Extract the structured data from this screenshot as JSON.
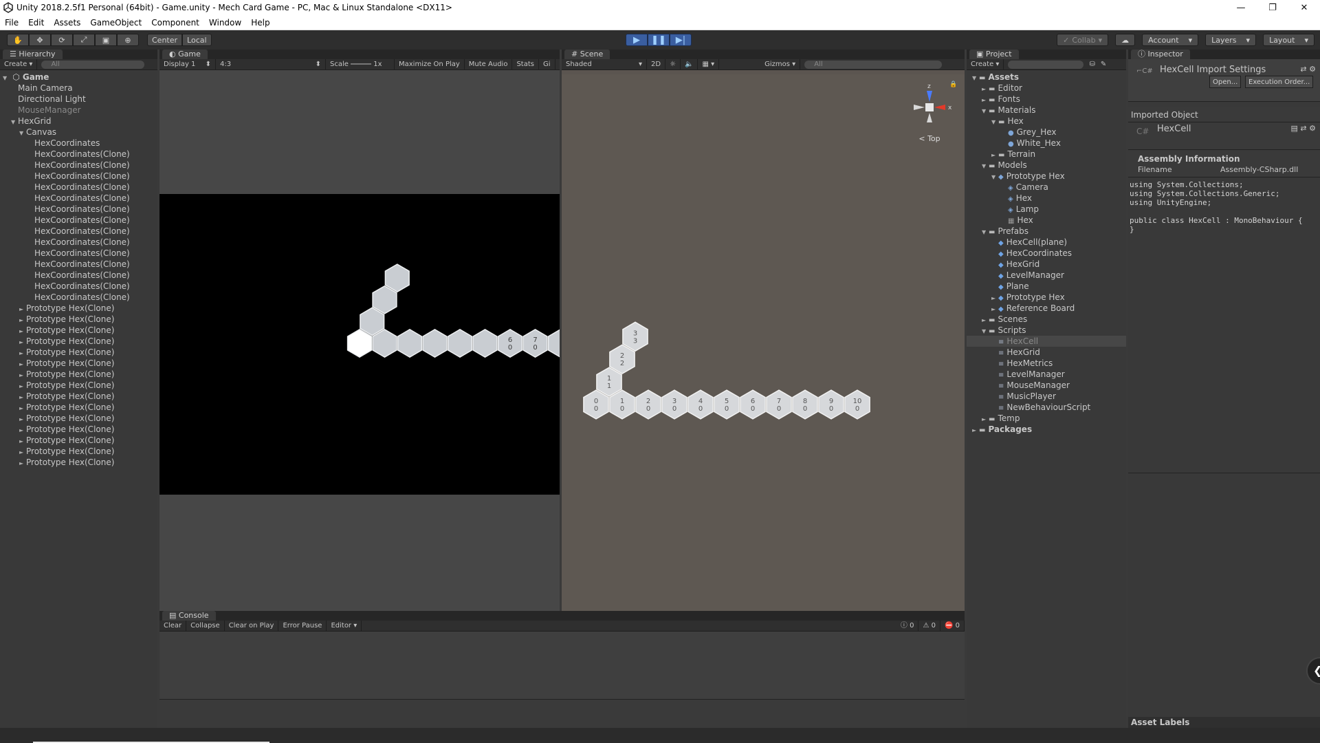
{
  "window": {
    "title": "Unity 2018.2.5f1 Personal (64bit) - Game.unity - Mech Card Game - PC, Mac & Linux Standalone <DX11>",
    "controls": [
      "minimize-icon",
      "restore-icon",
      "close-icon"
    ]
  },
  "menu": [
    "File",
    "Edit",
    "Assets",
    "GameObject",
    "Component",
    "Window",
    "Help"
  ],
  "toolbar": {
    "tools": [
      "hand-icon",
      "move-icon",
      "rotate-icon",
      "scale-icon",
      "rect-icon",
      "transform-icon"
    ],
    "pivot": "Center",
    "space": "Local",
    "play_state": "playing",
    "collab": "Collab",
    "account": "Account",
    "layers": "Layers",
    "layout": "Layout",
    "accent": "#3a5ea0"
  },
  "hierarchy": {
    "tab": "Hierarchy",
    "create": "Create",
    "search_placeholder": "All",
    "scene": "Game",
    "items": [
      {
        "label": "Main Camera",
        "depth": 1,
        "arrow": "",
        "dim": false
      },
      {
        "label": "Directional Light",
        "depth": 1,
        "arrow": "",
        "dim": false
      },
      {
        "label": "MouseManager",
        "depth": 1,
        "arrow": "",
        "dim": true
      },
      {
        "label": "HexGrid",
        "depth": 1,
        "arrow": "▼",
        "dim": false
      },
      {
        "label": "Canvas",
        "depth": 2,
        "arrow": "▼",
        "dim": false
      },
      {
        "label": "HexCoordinates",
        "depth": 3,
        "arrow": "",
        "dim": false
      },
      {
        "label": "HexCoordinates(Clone)",
        "depth": 3,
        "arrow": "",
        "dim": false
      },
      {
        "label": "HexCoordinates(Clone)",
        "depth": 3,
        "arrow": "",
        "dim": false
      },
      {
        "label": "HexCoordinates(Clone)",
        "depth": 3,
        "arrow": "",
        "dim": false
      },
      {
        "label": "HexCoordinates(Clone)",
        "depth": 3,
        "arrow": "",
        "dim": false
      },
      {
        "label": "HexCoordinates(Clone)",
        "depth": 3,
        "arrow": "",
        "dim": false
      },
      {
        "label": "HexCoordinates(Clone)",
        "depth": 3,
        "arrow": "",
        "dim": false
      },
      {
        "label": "HexCoordinates(Clone)",
        "depth": 3,
        "arrow": "",
        "dim": false
      },
      {
        "label": "HexCoordinates(Clone)",
        "depth": 3,
        "arrow": "",
        "dim": false
      },
      {
        "label": "HexCoordinates(Clone)",
        "depth": 3,
        "arrow": "",
        "dim": false
      },
      {
        "label": "HexCoordinates(Clone)",
        "depth": 3,
        "arrow": "",
        "dim": false
      },
      {
        "label": "HexCoordinates(Clone)",
        "depth": 3,
        "arrow": "",
        "dim": false
      },
      {
        "label": "HexCoordinates(Clone)",
        "depth": 3,
        "arrow": "",
        "dim": false
      },
      {
        "label": "HexCoordinates(Clone)",
        "depth": 3,
        "arrow": "",
        "dim": false
      },
      {
        "label": "HexCoordinates(Clone)",
        "depth": 3,
        "arrow": "",
        "dim": false
      },
      {
        "label": "Prototype Hex(Clone)",
        "depth": 2,
        "arrow": "►",
        "dim": false
      },
      {
        "label": "Prototype Hex(Clone)",
        "depth": 2,
        "arrow": "►",
        "dim": false
      },
      {
        "label": "Prototype Hex(Clone)",
        "depth": 2,
        "arrow": "►",
        "dim": false
      },
      {
        "label": "Prototype Hex(Clone)",
        "depth": 2,
        "arrow": "►",
        "dim": false
      },
      {
        "label": "Prototype Hex(Clone)",
        "depth": 2,
        "arrow": "►",
        "dim": false
      },
      {
        "label": "Prototype Hex(Clone)",
        "depth": 2,
        "arrow": "►",
        "dim": false
      },
      {
        "label": "Prototype Hex(Clone)",
        "depth": 2,
        "arrow": "►",
        "dim": false
      },
      {
        "label": "Prototype Hex(Clone)",
        "depth": 2,
        "arrow": "►",
        "dim": false
      },
      {
        "label": "Prototype Hex(Clone)",
        "depth": 2,
        "arrow": "►",
        "dim": false
      },
      {
        "label": "Prototype Hex(Clone)",
        "depth": 2,
        "arrow": "►",
        "dim": false
      },
      {
        "label": "Prototype Hex(Clone)",
        "depth": 2,
        "arrow": "►",
        "dim": false
      },
      {
        "label": "Prototype Hex(Clone)",
        "depth": 2,
        "arrow": "►",
        "dim": false
      },
      {
        "label": "Prototype Hex(Clone)",
        "depth": 2,
        "arrow": "►",
        "dim": false
      },
      {
        "label": "Prototype Hex(Clone)",
        "depth": 2,
        "arrow": "►",
        "dim": false
      },
      {
        "label": "Prototype Hex(Clone)",
        "depth": 2,
        "arrow": "►",
        "dim": false
      }
    ]
  },
  "game": {
    "tab": "Game",
    "display": "Display 1",
    "aspect": "4:3",
    "scale_label": "Scale",
    "scale_value": "1x",
    "maximize": "Maximize On Play",
    "mute": "Mute Audio",
    "stats": "Stats",
    "gizmos": "Gi",
    "cells": [
      {
        "q": 0,
        "r": 0,
        "l1": "",
        "l2": "",
        "bright": true
      },
      {
        "q": 1,
        "r": 0,
        "l1": "",
        "l2": "",
        "bright": false
      },
      {
        "q": 2,
        "r": 0,
        "l1": "",
        "l2": "",
        "bright": false
      },
      {
        "q": 3,
        "r": 0,
        "l1": "",
        "l2": "",
        "bright": false
      },
      {
        "q": 4,
        "r": 0,
        "l1": "",
        "l2": "",
        "bright": false
      },
      {
        "q": 5,
        "r": 0,
        "l1": "",
        "l2": "",
        "bright": false
      },
      {
        "q": 6,
        "r": 0,
        "l1": "6",
        "l2": "0",
        "bright": false
      },
      {
        "q": 7,
        "r": 0,
        "l1": "7",
        "l2": "0",
        "bright": false
      },
      {
        "q": 8,
        "r": 0,
        "l1": "",
        "l2": "",
        "bright": false
      },
      {
        "q": 0,
        "r": 1,
        "l1": "",
        "l2": "",
        "bright": false
      },
      {
        "q": 0,
        "r": 2,
        "l1": "",
        "l2": "",
        "bright": false
      },
      {
        "q": 0,
        "r": 3,
        "l1": "",
        "l2": "",
        "bright": false
      }
    ]
  },
  "scene": {
    "tab": "Scene",
    "shading": "Shaded",
    "mode2d": "2D",
    "gizmos": "Gizmos",
    "search_placeholder": "All",
    "orientation": "Top",
    "axes": {
      "z": "z",
      "x": "x"
    },
    "cells": [
      {
        "q": 0,
        "r": 0,
        "l1": "0",
        "l2": "0"
      },
      {
        "q": 1,
        "r": 0,
        "l1": "1",
        "l2": "0"
      },
      {
        "q": 2,
        "r": 0,
        "l1": "2",
        "l2": "0"
      },
      {
        "q": 3,
        "r": 0,
        "l1": "3",
        "l2": "0"
      },
      {
        "q": 4,
        "r": 0,
        "l1": "4",
        "l2": "0"
      },
      {
        "q": 5,
        "r": 0,
        "l1": "5",
        "l2": "0"
      },
      {
        "q": 6,
        "r": 0,
        "l1": "6",
        "l2": "0"
      },
      {
        "q": 7,
        "r": 0,
        "l1": "7",
        "l2": "0"
      },
      {
        "q": 8,
        "r": 0,
        "l1": "8",
        "l2": "0"
      },
      {
        "q": 9,
        "r": 0,
        "l1": "9",
        "l2": "0"
      },
      {
        "q": 10,
        "r": 0,
        "l1": "10",
        "l2": "0"
      },
      {
        "q": 0,
        "r": 1,
        "l1": "1",
        "l2": "1"
      },
      {
        "q": 0,
        "r": 2,
        "l1": "2",
        "l2": "2"
      },
      {
        "q": 0,
        "r": 3,
        "l1": "3",
        "l2": "3"
      }
    ]
  },
  "console": {
    "tab": "Console",
    "buttons": [
      "Clear",
      "Collapse",
      "Clear on Play",
      "Error Pause",
      "Editor"
    ],
    "counts": {
      "info": "0",
      "warning": "0",
      "error": "0"
    }
  },
  "project": {
    "tab": "Project",
    "create": "Create",
    "items": [
      {
        "label": "Assets",
        "depth": 0,
        "arrow": "▼",
        "icon": "folder",
        "bold": true,
        "selected": false
      },
      {
        "label": "Editor",
        "depth": 1,
        "arrow": "►",
        "icon": "folder",
        "bold": false,
        "selected": false
      },
      {
        "label": "Fonts",
        "depth": 1,
        "arrow": "►",
        "icon": "folder",
        "bold": false,
        "selected": false
      },
      {
        "label": "Materials",
        "depth": 1,
        "arrow": "▼",
        "icon": "folder",
        "bold": false,
        "selected": false
      },
      {
        "label": "Hex",
        "depth": 2,
        "arrow": "▼",
        "icon": "folder",
        "bold": false,
        "selected": false
      },
      {
        "label": "Grey_Hex",
        "depth": 3,
        "arrow": "",
        "icon": "material",
        "bold": false,
        "selected": false
      },
      {
        "label": "White_Hex",
        "depth": 3,
        "arrow": "",
        "icon": "material",
        "bold": false,
        "selected": false
      },
      {
        "label": "Terrain",
        "depth": 2,
        "arrow": "►",
        "icon": "folder",
        "bold": false,
        "selected": false
      },
      {
        "label": "Models",
        "depth": 1,
        "arrow": "▼",
        "icon": "folder",
        "bold": false,
        "selected": false
      },
      {
        "label": "Prototype Hex",
        "depth": 2,
        "arrow": "▼",
        "icon": "model",
        "bold": false,
        "selected": false
      },
      {
        "label": "Camera",
        "depth": 3,
        "arrow": "",
        "icon": "mesh",
        "bold": false,
        "selected": false
      },
      {
        "label": "Hex",
        "depth": 3,
        "arrow": "",
        "icon": "mesh",
        "bold": false,
        "selected": false
      },
      {
        "label": "Lamp",
        "depth": 3,
        "arrow": "",
        "icon": "mesh",
        "bold": false,
        "selected": false
      },
      {
        "label": "Hex",
        "depth": 3,
        "arrow": "",
        "icon": "grid",
        "bold": false,
        "selected": false
      },
      {
        "label": "Prefabs",
        "depth": 1,
        "arrow": "▼",
        "icon": "folder",
        "bold": false,
        "selected": false
      },
      {
        "label": "HexCell(plane)",
        "depth": 2,
        "arrow": "",
        "icon": "prefab",
        "bold": false,
        "selected": false
      },
      {
        "label": "HexCoordinates",
        "depth": 2,
        "arrow": "",
        "icon": "prefab",
        "bold": false,
        "selected": false
      },
      {
        "label": "HexGrid",
        "depth": 2,
        "arrow": "",
        "icon": "prefab",
        "bold": false,
        "selected": false
      },
      {
        "label": "LevelManager",
        "depth": 2,
        "arrow": "",
        "icon": "prefab",
        "bold": false,
        "selected": false
      },
      {
        "label": "Plane",
        "depth": 2,
        "arrow": "",
        "icon": "prefab",
        "bold": false,
        "selected": false
      },
      {
        "label": "Prototype Hex",
        "depth": 2,
        "arrow": "►",
        "icon": "prefab",
        "bold": false,
        "selected": false
      },
      {
        "label": "Reference Board",
        "depth": 2,
        "arrow": "►",
        "icon": "prefab",
        "bold": false,
        "selected": false
      },
      {
        "label": "Scenes",
        "depth": 1,
        "arrow": "►",
        "icon": "folder",
        "bold": false,
        "selected": false
      },
      {
        "label": "Scripts",
        "depth": 1,
        "arrow": "▼",
        "icon": "folder",
        "bold": false,
        "selected": false
      },
      {
        "label": "HexCell",
        "depth": 2,
        "arrow": "",
        "icon": "script",
        "bold": false,
        "selected": true
      },
      {
        "label": "HexGrid",
        "depth": 2,
        "arrow": "",
        "icon": "script",
        "bold": false,
        "selected": false
      },
      {
        "label": "HexMetrics",
        "depth": 2,
        "arrow": "",
        "icon": "script",
        "bold": false,
        "selected": false
      },
      {
        "label": "LevelManager",
        "depth": 2,
        "arrow": "",
        "icon": "script",
        "bold": false,
        "selected": false
      },
      {
        "label": "MouseManager",
        "depth": 2,
        "arrow": "",
        "icon": "script",
        "bold": false,
        "selected": false
      },
      {
        "label": "MusicPlayer",
        "depth": 2,
        "arrow": "",
        "icon": "script",
        "bold": false,
        "selected": false
      },
      {
        "label": "NewBehaviourScript",
        "depth": 2,
        "arrow": "",
        "icon": "script",
        "bold": false,
        "selected": false
      },
      {
        "label": "Temp",
        "depth": 1,
        "arrow": "►",
        "icon": "folder",
        "bold": false,
        "selected": false
      },
      {
        "label": "Packages",
        "depth": 0,
        "arrow": "►",
        "icon": "folder",
        "bold": true,
        "selected": false
      }
    ]
  },
  "inspector": {
    "tab": "Inspector",
    "title": "HexCell Import Settings",
    "open": "Open...",
    "execution_order": "Execution Order...",
    "imported_object": "Imported Object",
    "object_name": "HexCell",
    "cs_icon": "C#",
    "assembly_heading": "Assembly Information",
    "filename_label": "Filename",
    "filename_value": "Assembly-CSharp.dll",
    "code": "using System.Collections;\nusing System.Collections.Generic;\nusing UnityEngine;\n\npublic class HexCell : MonoBehaviour {\n}",
    "asset_labels": "Asset Labels"
  }
}
